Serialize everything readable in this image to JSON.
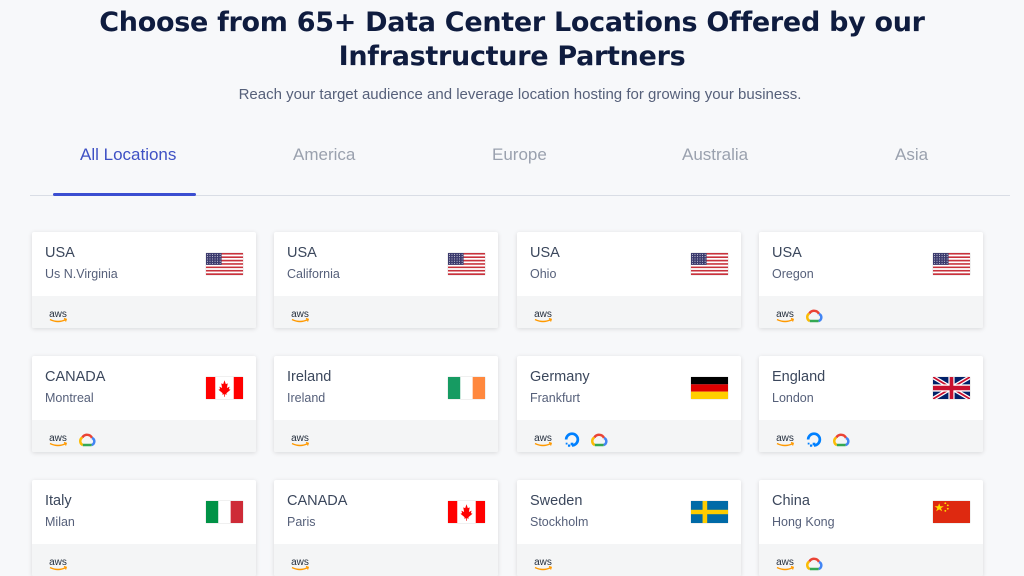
{
  "header": {
    "title_line1": "Choose from 65+ Data Center Locations Offered by our",
    "title_line2": "Infrastructure Partners",
    "subtitle": "Reach your target audience and leverage location hosting for growing your business."
  },
  "tabs": [
    {
      "label": "All Locations",
      "active": true
    },
    {
      "label": "America",
      "active": false
    },
    {
      "label": "Europe",
      "active": false
    },
    {
      "label": "Australia",
      "active": false
    },
    {
      "label": "Asia",
      "active": false
    }
  ],
  "colors": {
    "accent": "#3b4ed1",
    "title": "#0f1c3f"
  },
  "locations": [
    {
      "country": "USA",
      "city": "Us N.Virginia",
      "flag": "us",
      "providers": [
        "aws"
      ]
    },
    {
      "country": "USA",
      "city": "California",
      "flag": "us",
      "providers": [
        "aws"
      ]
    },
    {
      "country": "USA",
      "city": "Ohio",
      "flag": "us",
      "providers": [
        "aws"
      ]
    },
    {
      "country": "USA",
      "city": "Oregon",
      "flag": "us",
      "providers": [
        "aws",
        "google-cloud"
      ]
    },
    {
      "country": "CANADA",
      "city": "Montreal",
      "flag": "ca",
      "providers": [
        "aws",
        "google-cloud"
      ]
    },
    {
      "country": "Ireland",
      "city": "Ireland",
      "flag": "ie",
      "providers": [
        "aws"
      ]
    },
    {
      "country": "Germany",
      "city": "Frankfurt",
      "flag": "de",
      "providers": [
        "aws",
        "digitalocean",
        "google-cloud"
      ]
    },
    {
      "country": "England",
      "city": "London",
      "flag": "gb",
      "providers": [
        "aws",
        "digitalocean",
        "google-cloud"
      ]
    },
    {
      "country": "Italy",
      "city": "Milan",
      "flag": "it",
      "providers": [
        "aws"
      ]
    },
    {
      "country": "CANADA",
      "city": "Paris",
      "flag": "ca",
      "providers": [
        "aws"
      ]
    },
    {
      "country": "Sweden",
      "city": "Stockholm",
      "flag": "se",
      "providers": [
        "aws"
      ]
    },
    {
      "country": "China",
      "city": "Hong Kong",
      "flag": "cn",
      "providers": [
        "aws",
        "google-cloud"
      ]
    }
  ]
}
